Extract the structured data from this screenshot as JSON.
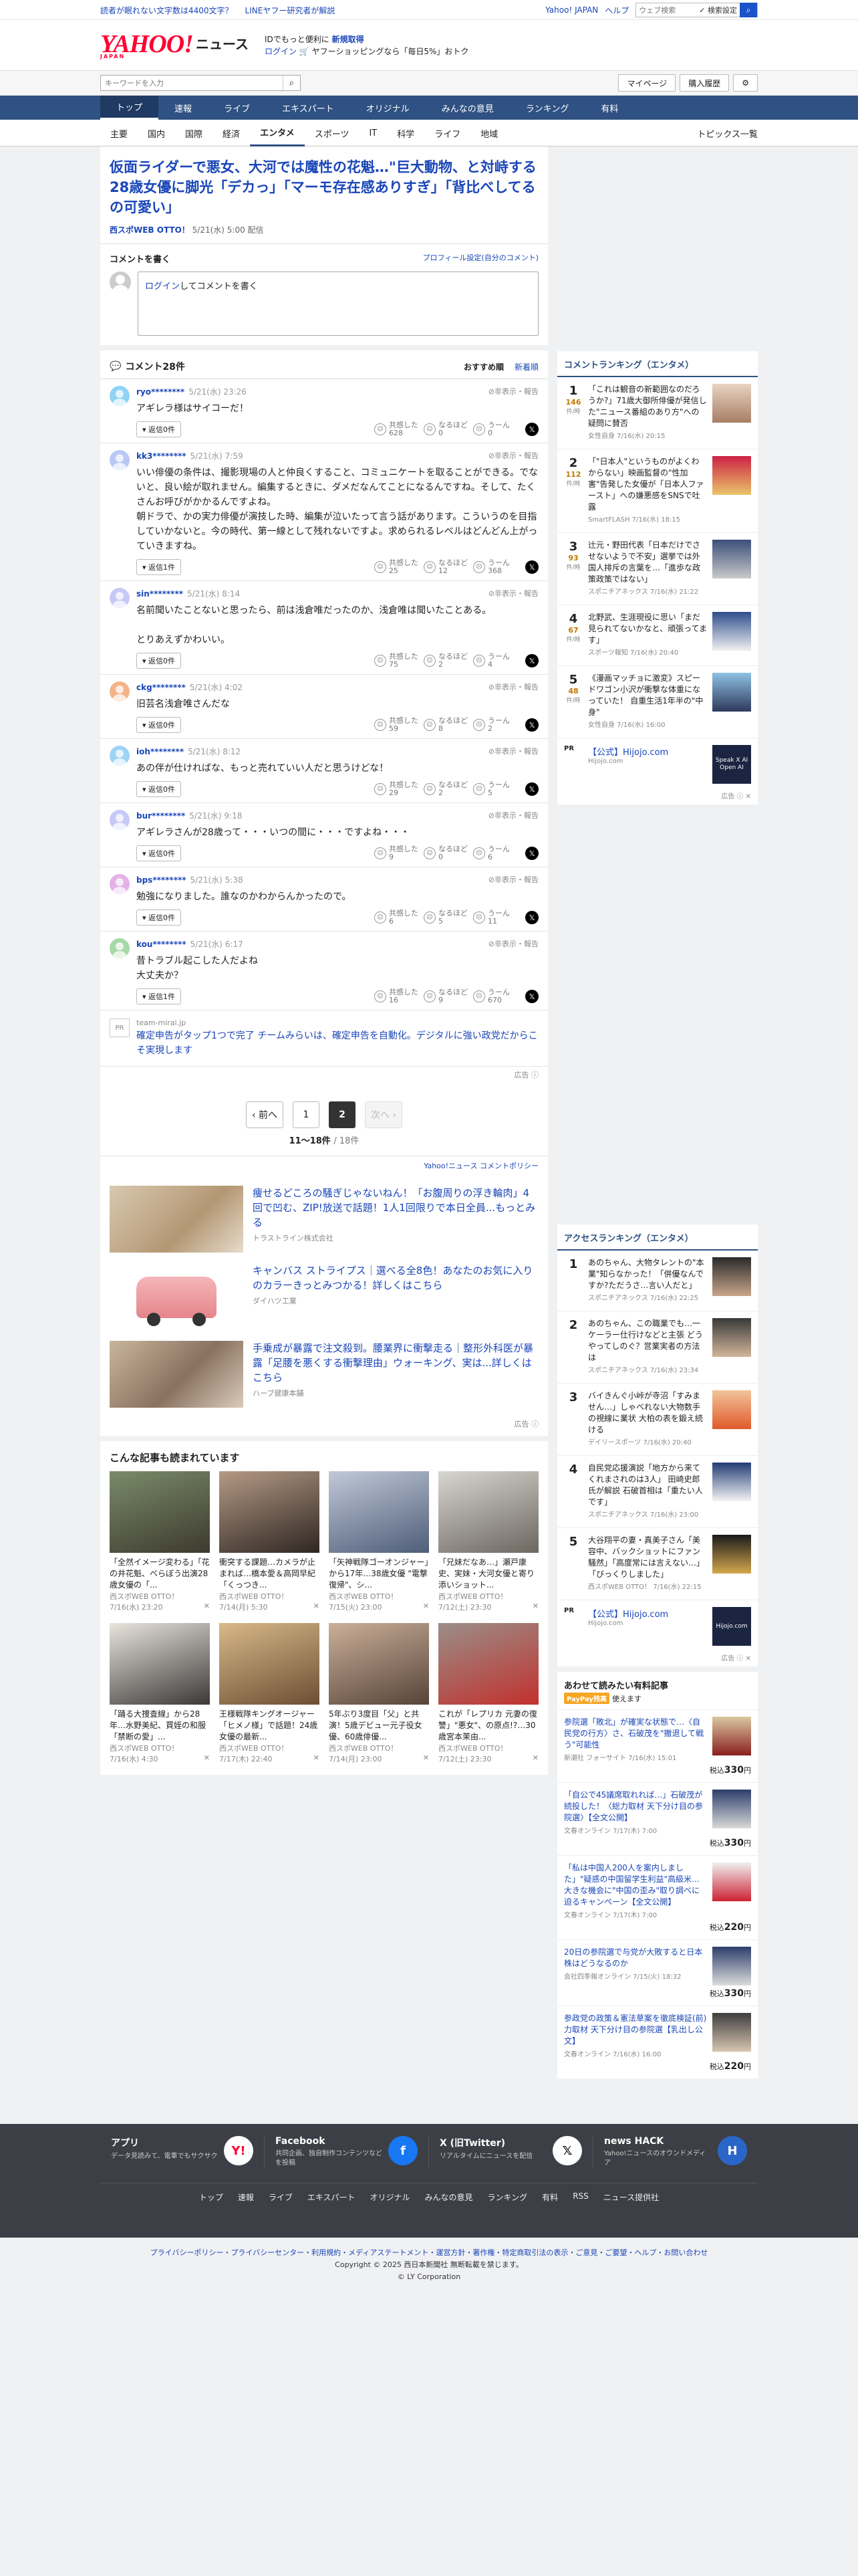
{
  "topstrip": {
    "links": [
      "読者が眠れない文字数は4400文字？",
      "LINEヤフー研究者が解説"
    ],
    "right": [
      "Yahoo! JAPAN",
      "ヘルプ"
    ],
    "search_placeholder": "ウェブ検索",
    "search_check": "✓ 検索設定"
  },
  "header": {
    "logo": "YAHOO!",
    "logo_sub": "JAPAN",
    "logo_news": "ニュース",
    "promo_line1": "IDでもっと便利に",
    "promo_bold": "新規取得",
    "promo_login": "ログイン",
    "promo_line2": "🛒 ヤフーショッピングなら「毎日5%」おトク"
  },
  "searchrow": {
    "placeholder": "キーワードを入力",
    "mypage": "マイページ",
    "history": "購入履歴"
  },
  "mainnav": [
    "トップ",
    "速報",
    "ライブ",
    "エキスパート",
    "オリジナル",
    "みんなの意見",
    "ランキング",
    "有料"
  ],
  "subnav": [
    "主要",
    "国内",
    "国際",
    "経済",
    "エンタメ",
    "スポーツ",
    "IT",
    "科学",
    "ライフ",
    "地域"
  ],
  "subnav_right": "トピックス一覧",
  "article": {
    "title": "仮面ライダーで悪女、大河では魔性の花魁…\"巨大動物、と対峙する28歳女優に脚光「デカっ」「マーモ存在感ありすぎ」「背比べしてるの可愛い」",
    "source": "西スポWEB OTTO！",
    "date": "5/21(水) 5:00 配信"
  },
  "comment_box": {
    "heading": "コメントを書く",
    "profile_link": "プロフィール設定(自分のコメント)",
    "login": "ログイン",
    "placeholder_rest": "してコメントを書く"
  },
  "comments_header": {
    "title": "コメント28件",
    "sort_recommended": "おすすめ順",
    "sort_new": "新着順"
  },
  "labels": {
    "hide": "非表示・報告",
    "reply": "返信0件",
    "reply1": "返信1件",
    "empathy": "共感した",
    "naruhodo": "なるほど",
    "uun": "うーん"
  },
  "comments": [
    {
      "user": "ryo********",
      "date": "5/21(水) 23:26",
      "text": "アギレラ様はサイコーだ！",
      "reply": "返信0件",
      "c1": "628",
      "c2": "0",
      "c3": "0",
      "color": "#8fd3f5"
    },
    {
      "user": "kk3********",
      "date": "5/21(水) 7:59",
      "text": "いい俳優の条件は、撮影現場の人と仲良くすること、コミュニケートを取ることができる。でないと、良い絵が取れません。編集するときに、ダメだなんてことになるんですね。そして、たくさんお呼びがかかるんですよね。\n朝ドラで、かの実力俳優が演技した時、編集が泣いたって言う話があります。こういうのを目指していかないと。今の時代、第一線として残れないですよ。求められるレベルはどんどん上がっていきますね。",
      "reply": "返信1件",
      "c1": "25",
      "c2": "12",
      "c3": "368",
      "color": "#b9c8f5"
    },
    {
      "user": "sin********",
      "date": "5/21(水) 8:14",
      "text": "名前聞いたことないと思ったら、前は浅倉唯だったのか、浅倉唯は聞いたことある。\n\nとりあえずかわいい。",
      "reply": "返信0件",
      "c1": "75",
      "c2": "2",
      "c3": "4",
      "color": "#c7c9f5"
    },
    {
      "user": "ckg********",
      "date": "5/21(水) 4:02",
      "text": "旧芸名浅倉唯さんだな",
      "reply": "返信0件",
      "c1": "59",
      "c2": "8",
      "c3": "2",
      "color": "#f5b38a"
    },
    {
      "user": "ioh********",
      "date": "5/21(水) 8:12",
      "text": "あの伴が仕ければな、もっと売れていい人だと思うけどな！",
      "reply": "返信0件",
      "c1": "29",
      "c2": "2",
      "c3": "5",
      "color": "#9ed3f5"
    },
    {
      "user": "bur********",
      "date": "5/21(水) 9:18",
      "text": "アギレラさんが28歳って・・・いつの間に・・・ですよね・・・",
      "reply": "返信0件",
      "c1": "9",
      "c2": "0",
      "c3": "6",
      "color": "#c7c9f5"
    },
    {
      "user": "bps********",
      "date": "5/21(水) 5:38",
      "text": "勉強になりました。誰なのかわからんかったので。",
      "reply": "返信0件",
      "c1": "6",
      "c2": "5",
      "c3": "11",
      "color": "#e3b1e8"
    },
    {
      "user": "kou********",
      "date": "5/21(水) 6:17",
      "text": "昔トラブル起こした人だよね\n大丈夫か？",
      "reply": "返信1件",
      "c1": "16",
      "c2": "9",
      "c3": "670",
      "color": "#a6d9a6"
    }
  ],
  "inline_ad": {
    "pr": "PR",
    "url": "team-mirai.jp",
    "text": "確定申告がタップ1つで完了 チームみらいは、確定申告を自動化。デジタルに強い政党だからこそ実現します",
    "ad_label": "広告 ⓘ"
  },
  "pager": {
    "prev": "‹ 前へ",
    "p1": "1",
    "p2": "2",
    "next": "次へ ›",
    "count": "11〜18件",
    "total": "/ 18件"
  },
  "policy": "Yahoo!ニュース コメントポリシー",
  "ads2": [
    {
      "title": "痩せるどころの騒ぎじゃないねん！「お腹周りの浮き輪肉」4回で凹む、ZIP!放送で話題！1人1回限りで本日全員...もっとみる",
      "sponsor": "トラストライン株式会社"
    },
    {
      "title": "キャンバス ストライプス｜選べる全8色！あなたのお気に入りのカラーきっとみつかる！詳しくはこちら",
      "sponsor": "ダイハツ工業"
    },
    {
      "title": "手乗成が暴露で注文殺到。腰業界に衝撃走る｜整形外科医が暴露「足腰を悪くする衝撃理由」ウォーキング、実は...詳しくはこちら",
      "sponsor": "ハーブ健康本舗"
    }
  ],
  "ads2_label": "広告 ⓘ",
  "recommend_heading": "こんな記事も読まれています",
  "recommend": [
    {
      "t": "「全然イメージ変わる」「花の井花魁、べらぼう出演28歳女優の「...",
      "s": "西スポWEB OTTO！",
      "d": "7/16(水) 23:20"
    },
    {
      "t": "衝突する課題…カメラが止まれば…橋本愛＆高岡早紀「くっつき...",
      "s": "西スポWEB OTTO！",
      "d": "7/14(月) 5:30"
    },
    {
      "t": "「矢神戦隊ゴーオンジャー」から17年…38歳女優 \"電撃復帰\"、シ...",
      "s": "西スポWEB OTTO！",
      "d": "7/15(火) 23:00"
    },
    {
      "t": "「兄妹だなあ…」瀬戸康史、実妹・大河女優と寄り添いショット...",
      "s": "西スポWEB OTTO！",
      "d": "7/12(土) 23:30"
    },
    {
      "t": "「踊る大捜査線」から28年…水野美紀、買姪の和服「禁断の愛」...",
      "s": "西スポWEB OTTO！",
      "d": "7/16(水) 4:30"
    },
    {
      "t": "王様戦隊キングオージャー「ヒメノ様」で話題！24歳女優の最新...",
      "s": "西スポWEB OTTO！",
      "d": "7/17(木) 22:40"
    },
    {
      "t": "5年ぶり3度目「父」と共演！5歳デビュー元子役女優、60歳俳優...",
      "s": "西スポWEB OTTO！",
      "d": "7/14(月) 23:00"
    },
    {
      "t": "これが「レプリカ 元妻の復讐」\"悪女\"、の原点!?…30歳宮本茉由...",
      "s": "西スポWEB OTTO！",
      "d": "7/12(土) 23:30"
    }
  ],
  "side": {
    "comment_ranking_title": "コメントランキング（エンタメ）",
    "comment_ranking": [
      {
        "num": "1",
        "cnt": "146",
        "unit": "件/時",
        "t": "「これは観音の新範囲なのだろうか?」71歳大御所俳優が発信した\"ニュース番組のあり方\"への疑問に賛否",
        "m": "女性自身 7/16(水) 20:15"
      },
      {
        "num": "2",
        "cnt": "112",
        "unit": "件/時",
        "t": "「\"日本人\"というものがよくわからない」映画監督の\"性加害\"告発した女優が「日本人ファースト」への嫌悪感をSNSで吐露",
        "m": "SmartFLASH 7/16(水) 18:15"
      },
      {
        "num": "3",
        "cnt": "93",
        "unit": "件/時",
        "t": "辻元・野田代表「日本だけでさせないようで不安」選挙では外国人排斥の言葉を…「進歩な政策政策ではない」",
        "m": "スポニチアネックス 7/16(水) 21:22"
      },
      {
        "num": "4",
        "cnt": "67",
        "unit": "件/時",
        "t": "北野武、生涯現役に思い「まだ見られてないかなと、頑張ってます」",
        "m": "スポーツ報知 7/16(水) 20:40"
      },
      {
        "num": "5",
        "cnt": "48",
        "unit": "件/時",
        "t": "《漫画マッチョに激変》スピードワゴン小沢が衝撃な体重になっていた！ 自重生活1年半の\"中身\"",
        "m": "女性自身 7/16(水) 16:00"
      }
    ],
    "side_ad1": {
      "pr": "PR",
      "t": "【公式】Hijojo.com",
      "u": "Hijojo.com",
      "thumb": "Speak X Al Open AI"
    },
    "side_ad1_label": "広告 ⓘ ✕",
    "access_ranking_title": "アクセスランキング（エンタメ）",
    "access_ranking": [
      {
        "num": "1",
        "t": "あのちゃん、大物タレントの\"本業\"知らなかった！「併優なんですか?ただうさ…言い人だと」",
        "m": "スポニチアネックス 7/16(水) 22:25"
      },
      {
        "num": "2",
        "t": "あのちゃん、この職業でも…一ケーラー仕行けなどと主張 どうやってしのぐ？営業実者の方法は",
        "m": "スポニチアネックス 7/16(水) 23:34"
      },
      {
        "num": "3",
        "t": "バイきんぐ小峠が寺沼「すみません…」しゃべれない大物数手の視線に業状 大柏の表を鍛え続ける",
        "m": "デイリースポーツ 7/16(水) 20:40"
      },
      {
        "num": "4",
        "t": "自民党応援演説「地方から来てくれまされのは3人」 田崎史郎氏が解説 石破首相は「重たい人です」",
        "m": "スポニチアネックス 7/16(水) 23:00"
      },
      {
        "num": "5",
        "t": "大谷翔平の妻・真美子さん「美容中、バックショットにファン騒然」「高度常には言えない…」「びっくりしました」",
        "m": "西スポWEB OTTO！ 7/16(水) 22:15"
      }
    ],
    "side_ad2": {
      "pr": "PR",
      "t": "【公式】Hijojo.com",
      "u": "Hijojo.com",
      "thumb": "Hijojo.com"
    },
    "side_ad2_label": "広告 ⓘ ✕",
    "paid_title": "あわせて読みたい有料記事",
    "paid_sub_badge": "PayPay残高",
    "paid_sub_text": "使えます",
    "paid": [
      {
        "t": "参院選「敗北」が確実な状態で…〈自民党の行方〉さ、石破茂を\"撤退して戦う\"可能性",
        "m": "新潮社 フォーサイト 7/16(水) 15:01",
        "price": "330"
      },
      {
        "t": "「自公で45議席取れれば…」石破茂が続投した！〈総力取材 天下分け目の参院選〉【全文公開】",
        "m": "文春オンライン 7/17(木) 7:00",
        "price": "330"
      },
      {
        "t": "「私は中国人200人を案内しました」\"疑惑の中国留学生利益\"高級米…大きな機会に\"中国の歪み\"取り調べに迫るキャンペーン【全文公開】",
        "m": "文春オンライン 7/17(木) 7:00",
        "price": "220"
      },
      {
        "t": "20日の参院選で与党が大敗すると日本株はどうなるのか",
        "m": "会社四季報オンライン 7/15(火) 18:32",
        "price": "330"
      },
      {
        "t": "参政党の政策＆憲法草案を徹底検証(前)力取材 天下分け目の参院選【乳出し公文】",
        "m": "文春オンライン 7/16(水) 16:00",
        "price": "220"
      }
    ],
    "price_prefix": "税込",
    "price_suffix": "円"
  },
  "footer": {
    "boxes": [
      {
        "t": "アプリ",
        "d": "データ見読みて、電車でもサクサク",
        "ic": "Y!",
        "bg": "#ffffff",
        "fg": "#ff0033"
      },
      {
        "t": "Facebook",
        "d": "共同企画、独自制作コンテンツなどを投稿",
        "ic": "f",
        "bg": "#1877f2",
        "fg": "#ffffff"
      },
      {
        "t": "X (旧Twitter)",
        "d": "リアルタイムにニュースを配信",
        "ic": "𝕏",
        "bg": "#ffffff",
        "fg": "#000000"
      },
      {
        "t": "news HACK",
        "d": "Yahoo!ニュースのオウンドメディア",
        "ic": "H",
        "bg": "#2a66c7",
        "fg": "#ffffff"
      }
    ],
    "links": [
      "トップ",
      "速報",
      "ライブ",
      "エキスパート",
      "オリジナル",
      "みんなの意見",
      "ランキング",
      "有料",
      "RSS",
      "ニュース提供社"
    ],
    "policy": "プライバシーポリシー・プライバシーセンター・利用規約・メディアステートメント・運営方針・著作権・特定商取引法の表示・ご意見・ご要望・ヘルプ・お問い合わせ",
    "copyright1": "Copyright © 2025 西日本新聞社 無断転載を禁じます。",
    "copyright2": "© LY Corporation"
  },
  "colors": {
    "nav": "#2f5183",
    "link": "#1a46b8",
    "logo": "#ff0033"
  }
}
